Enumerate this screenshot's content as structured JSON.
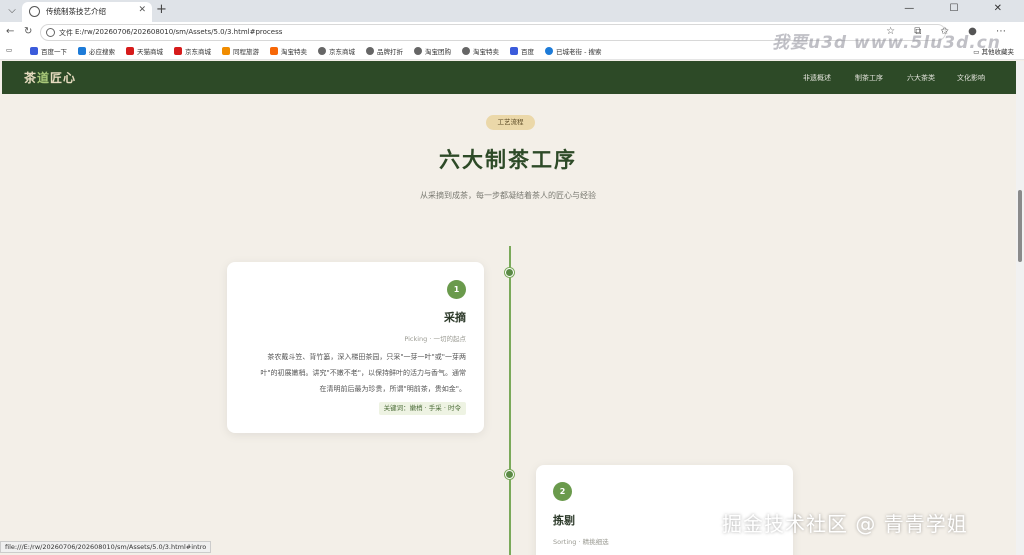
{
  "browser": {
    "tab_title": "传统制茶技艺介绍",
    "tab_close": "✕",
    "new_tab": "+",
    "url_label": "文件",
    "url": "E:/rw/20260706/202608010/sm/Assets/5.0/3.html#process",
    "status_url": "file:///E:/rw/20260706/202608010/sm/Assets/5.0/3.html#intro",
    "bookmarks": [
      {
        "label": "百度一下",
        "color": "#3b5bdb"
      },
      {
        "label": "必应搜索",
        "color": "#1d7bd8"
      },
      {
        "label": "天猫商城",
        "color": "#d61b1b"
      },
      {
        "label": "京东商城",
        "color": "#d61b1b"
      },
      {
        "label": "同程旅游",
        "color": "#f08c00"
      },
      {
        "label": "淘宝特卖",
        "color": "#f76707"
      },
      {
        "label": "京东商城",
        "color": "#666666"
      },
      {
        "label": "品牌打折",
        "color": "#666666"
      },
      {
        "label": "淘宝团购",
        "color": "#666666"
      },
      {
        "label": "淘宝特卖",
        "color": "#666666"
      },
      {
        "label": "百度",
        "color": "#3b5bdb"
      },
      {
        "label": "已城老街 - 搜索",
        "color": "#1d7bd8"
      }
    ],
    "other_bookmarks": "其他收藏夹"
  },
  "watermarks": {
    "top": "我要u3d  www.5lu3d.cn",
    "bottom": "掘金技术社区 @ 青青学姐"
  },
  "site": {
    "logo_part1": "茶",
    "logo_part2": "道",
    "logo_part3": "匠心",
    "nav": [
      "非遗概述",
      "制茶工序",
      "六大茶类",
      "文化影响"
    ]
  },
  "section": {
    "tag": "工艺流程",
    "title": "六大制茶工序",
    "subtitle": "从采摘到成茶，每一步都凝结着茶人的匠心与经验"
  },
  "steps": [
    {
      "number": "1",
      "title": "采摘",
      "subtitle": "Picking · 一切的起点",
      "description_lines": [
        "茶农戴斗笠、背竹篓，深入梯田茶园，只采\"一芽一叶\"或\"一芽两",
        "叶\"的初展嫩梢。讲究\"不嫩不老\"，以保持鲜叶的活力与香气。通常",
        "在清明前后最为珍贵，所谓\"明前茶，贵如金\"。"
      ],
      "keywords": "关键词：嫩梢 · 手采 · 时令"
    },
    {
      "number": "2",
      "title": "拣剔",
      "subtitle": "Sorting · 精挑细选"
    }
  ],
  "colors": {
    "nav_bg": "#2d4a27",
    "accent_green": "#6a9a4c",
    "page_bg": "#f3efe8",
    "tag_bg": "#ebd8a9"
  }
}
